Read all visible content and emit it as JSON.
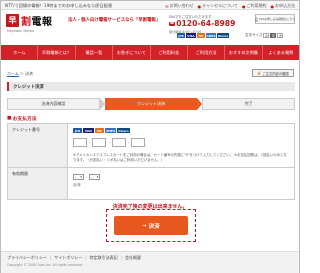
{
  "topbar": {
    "tagline": "NTT/う回線の電報！19時までのお申し込みなら即日配達",
    "links": [
      {
        "label": "お問い合わせ",
        "icon": "envelope-icon"
      },
      {
        "label": "キャンセルについて",
        "icon": "info-icon"
      },
      {
        "label": "ご利用規約",
        "icon": "document-icon"
      },
      {
        "label": "お申込方法",
        "icon": "question-icon"
      }
    ]
  },
  "header": {
    "logo_mark": "早",
    "logo_a": "早",
    "logo_b": "割",
    "logo_c": "電報",
    "sub_logo": "Hayawari Denpo",
    "catch": "法人・個人向け電報サービスなら「早割電報」",
    "phone_caption": "FAXでもご注文いただけます",
    "phone_free": "0120",
    "phone_number": "0120-64-8989",
    "phone_hours": "受付時間 8:00～20:00",
    "fax_label": "FAXお申し込み用紙はこちら",
    "font_size_label": "文字サイズ",
    "font_small": "小",
    "font_medium": "中",
    "font_large": "大"
  },
  "cards": [
    {
      "label": "JCB",
      "color": "#1b5aa8"
    },
    {
      "label": "VISA",
      "color": "#1a1f71"
    },
    {
      "label": "MC",
      "color": "#eb6d1c"
    },
    {
      "label": "AMEX",
      "color": "#2e77bb"
    },
    {
      "label": "Diners",
      "color": "#0b4b84"
    }
  ],
  "nav": [
    "ホーム",
    "早割電報とは？",
    "電話一覧",
    "お急ぎについて",
    "ご利用料金",
    "ご利用方法",
    "おすすめ文例集",
    "よくある質問"
  ],
  "breadcrumb": {
    "home": "ホーム",
    "sep": "＞",
    "current": "決済",
    "secure": "ご注文内容の確認"
  },
  "title": "クレジット決済",
  "steps": [
    "決済内容確認",
    "クレジット決済",
    "完了"
  ],
  "section_title": "お支払方法",
  "form": {
    "card_number_label": "クレジット番号",
    "card_sep": "-",
    "card_note": "※アメリカンエクスプレスカードをご利用の場合は、カード番号の先頭に\"0\"をつけて入力してください。 ※お支払回数は、1回払いのみとなります。（分割払い・リボ払いはご利用いただけません。）",
    "expiry_label": "有効期限",
    "expiry_month": "--",
    "expiry_year": "--",
    "expiry_month_unit": "月",
    "expiry_year_unit": "年",
    "expiry_note": "月/年"
  },
  "warning": "決済完了後の変更は出来ません。",
  "submit_label": "決済",
  "footer": {
    "links": [
      "プライバシーポリシー",
      "サイトポリシー",
      "特定取引法表記",
      "会社概要"
    ],
    "copyright": "Copyright © 2008 Ovas Inc. All rights reserved."
  }
}
